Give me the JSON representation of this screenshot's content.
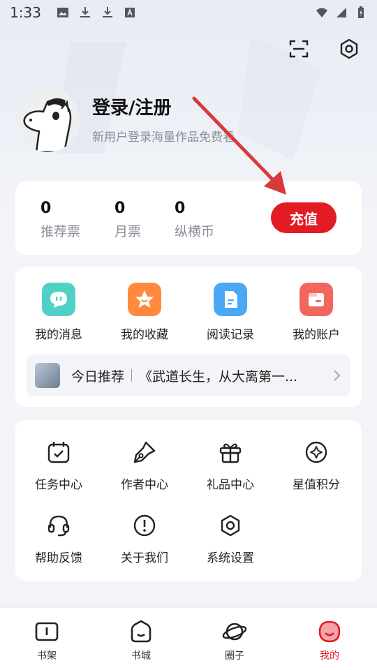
{
  "status_bar": {
    "time": "1:33"
  },
  "profile": {
    "title": "登录/注册",
    "subtitle": "新用户登录海量作品免费看"
  },
  "stats": {
    "items": [
      {
        "value": "0",
        "label": "推荐票"
      },
      {
        "value": "0",
        "label": "月票"
      },
      {
        "value": "0",
        "label": "纵横币"
      }
    ],
    "recharge_label": "充值"
  },
  "quick_actions": [
    {
      "label": "我的消息",
      "icon": "chat-bubble-icon",
      "color": "#4fd1c5"
    },
    {
      "label": "我的收藏",
      "icon": "star-face-icon",
      "color": "#ff8a3d"
    },
    {
      "label": "阅读记录",
      "icon": "document-icon",
      "color": "#4aa8f5"
    },
    {
      "label": "我的账户",
      "icon": "wallet-icon",
      "color": "#f2665e"
    }
  ],
  "recommendation": {
    "title": "今日推荐",
    "book": "《武道长生，从大离第一..."
  },
  "services": [
    {
      "label": "任务中心",
      "icon": "calendar-check-icon"
    },
    {
      "label": "作者中心",
      "icon": "pen-nib-icon"
    },
    {
      "label": "礼品中心",
      "icon": "gift-icon"
    },
    {
      "label": "星值积分",
      "icon": "star-diamond-icon"
    },
    {
      "label": "帮助反馈",
      "icon": "headset-icon"
    },
    {
      "label": "关于我们",
      "icon": "info-exclamation-icon"
    },
    {
      "label": "系统设置",
      "icon": "hexagon-settings-icon"
    }
  ],
  "bottom_nav": [
    {
      "label": "书架",
      "icon": "book-icon",
      "active": false
    },
    {
      "label": "书城",
      "icon": "store-icon",
      "active": false
    },
    {
      "label": "圈子",
      "icon": "planet-icon",
      "active": false
    },
    {
      "label": "我的",
      "icon": "face-icon",
      "active": true
    }
  ],
  "colors": {
    "accent": "#e31b23",
    "background": "#f3f4f8",
    "arrow": "#d8393a"
  }
}
